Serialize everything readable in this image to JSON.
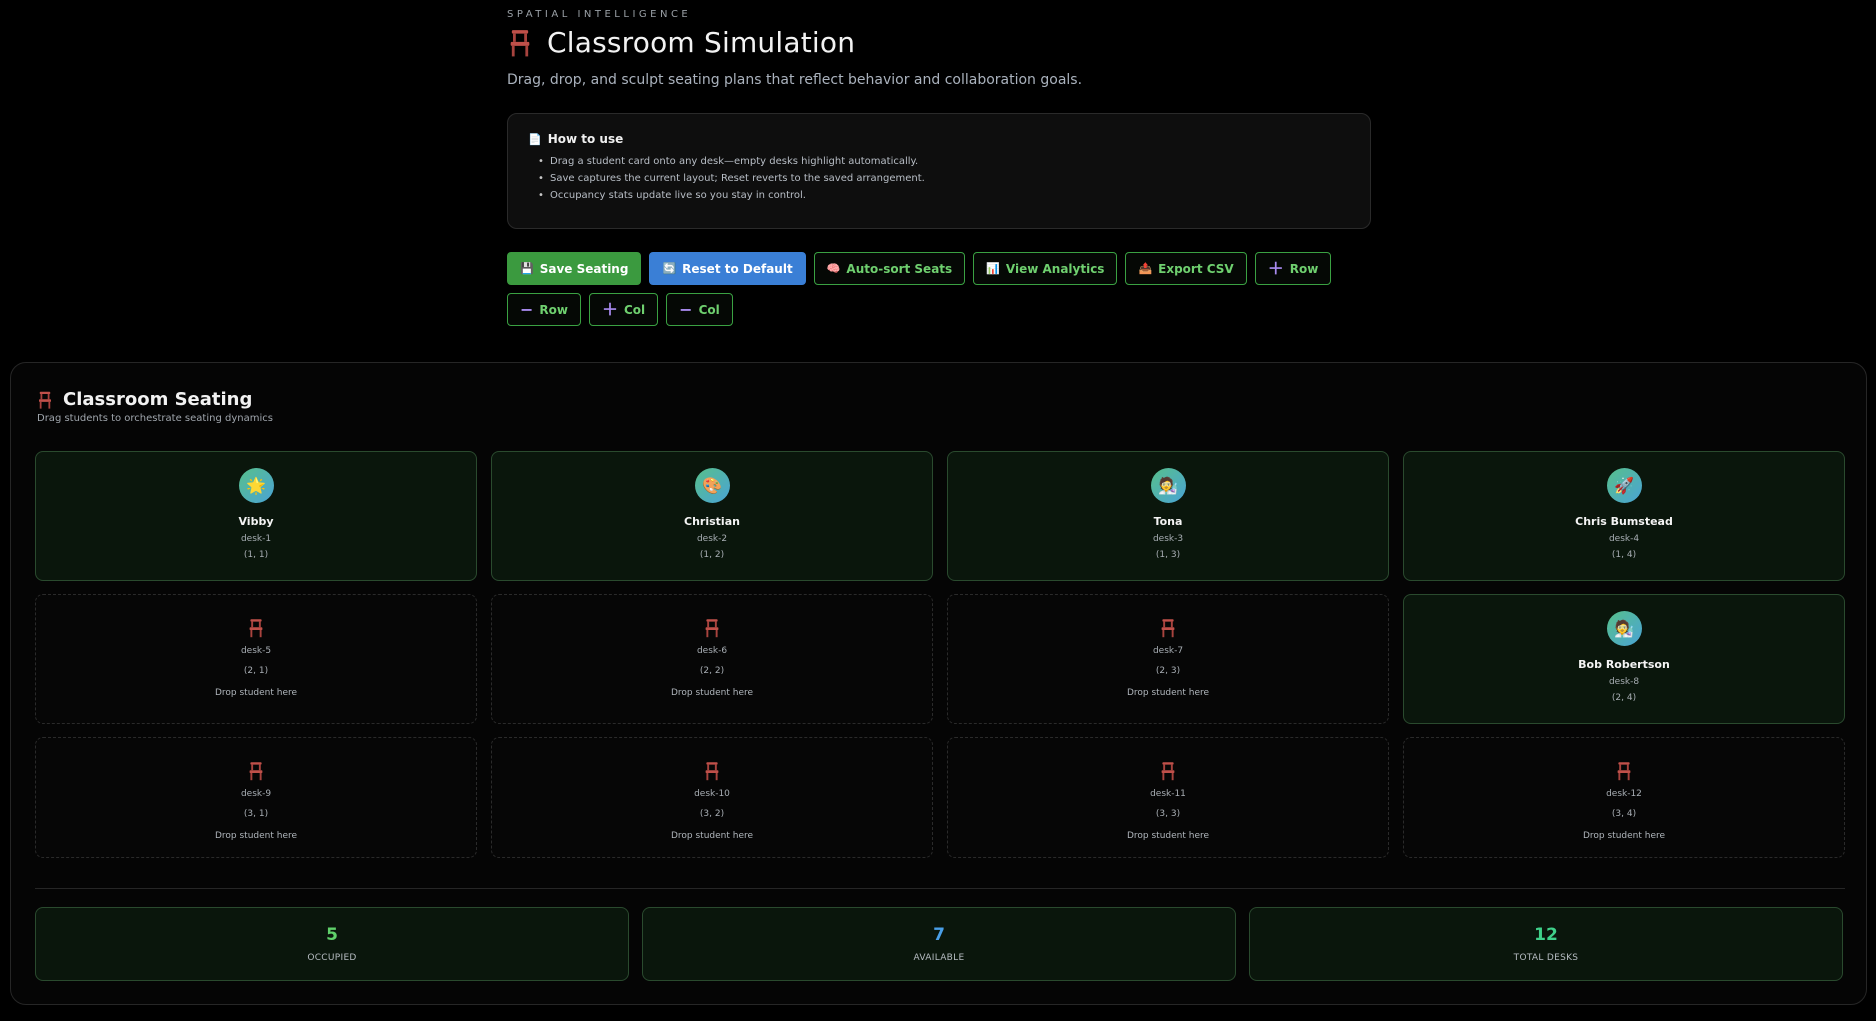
{
  "header": {
    "eyebrow": "SPATIAL INTELLIGENCE",
    "title": "Classroom Simulation",
    "subtitle": "Drag, drop, and sculpt seating plans that reflect behavior and collaboration goals."
  },
  "how_to_use": {
    "title": "How to use",
    "items": [
      "Drag a student card onto any desk—empty desks highlight automatically.",
      "Save captures the current layout; Reset reverts to the saved arrangement.",
      "Occupancy stats update live so you stay in control."
    ]
  },
  "toolbar": {
    "save": "Save Seating",
    "reset": "Reset to Default",
    "autosort": "Auto-sort Seats",
    "analytics": "View Analytics",
    "export": "Export CSV",
    "add_row": "Row",
    "remove_row": "Row",
    "add_col": "Col",
    "remove_col": "Col"
  },
  "seating": {
    "title": "Classroom Seating",
    "subtitle": "Drag students to orchestrate seating dynamics",
    "drop_hint": "Drop student here",
    "desks": [
      {
        "id": "desk-1",
        "coord": "(1, 1)",
        "student": "Vibby",
        "avatar": "🌟"
      },
      {
        "id": "desk-2",
        "coord": "(1, 2)",
        "student": "Christian",
        "avatar": "🎨"
      },
      {
        "id": "desk-3",
        "coord": "(1, 3)",
        "student": "Tona",
        "avatar": "🧑‍🔬"
      },
      {
        "id": "desk-4",
        "coord": "(1, 4)",
        "student": "Chris Bumstead",
        "avatar": "🚀"
      },
      {
        "id": "desk-5",
        "coord": "(2, 1)",
        "student": null
      },
      {
        "id": "desk-6",
        "coord": "(2, 2)",
        "student": null
      },
      {
        "id": "desk-7",
        "coord": "(2, 3)",
        "student": null
      },
      {
        "id": "desk-8",
        "coord": "(2, 4)",
        "student": "Bob Robertson",
        "avatar": "🧑‍🔬"
      },
      {
        "id": "desk-9",
        "coord": "(3, 1)",
        "student": null
      },
      {
        "id": "desk-10",
        "coord": "(3, 2)",
        "student": null
      },
      {
        "id": "desk-11",
        "coord": "(3, 3)",
        "student": null
      },
      {
        "id": "desk-12",
        "coord": "(3, 4)",
        "student": null
      }
    ]
  },
  "stats": {
    "occupied": {
      "value": "5",
      "label": "OCCUPIED",
      "color": "#5fd06a"
    },
    "available": {
      "value": "7",
      "label": "AVAILABLE",
      "color": "#4a9fe8"
    },
    "total": {
      "value": "12",
      "label": "TOTAL DESKS",
      "color": "#3fd08a"
    }
  },
  "colors": {
    "accent_green": "#3b9a3f",
    "accent_blue": "#3a7fd6",
    "chair": "#c0504a"
  }
}
